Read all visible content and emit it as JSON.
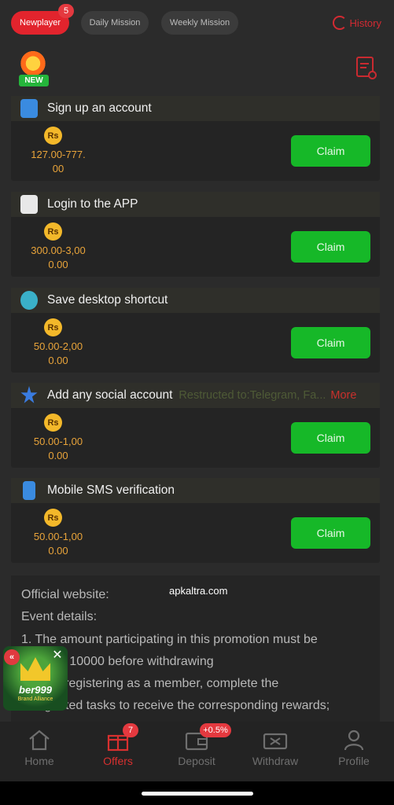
{
  "tabs": [
    {
      "label": "Newplayer",
      "badge": "5",
      "active": true
    },
    {
      "label": "Daily Mission",
      "active": false
    },
    {
      "label": "Weekly Mission",
      "active": false
    }
  ],
  "history_label": "History",
  "new_tag": "NEW",
  "currency_symbol": "Rs",
  "claim_label": "Claim",
  "tasks": [
    {
      "title": "Sign up an account",
      "note": "",
      "more": "",
      "reward_line1": "127.00-777.",
      "reward_line2": "00",
      "icon": "account-icon"
    },
    {
      "title": "Login to the APP",
      "note": "",
      "more": "",
      "reward_line1": "300.00-3,00",
      "reward_line2": "0.00",
      "icon": "app-icon"
    },
    {
      "title": "Save desktop shortcut",
      "note": "",
      "more": "",
      "reward_line1": "50.00-2,00",
      "reward_line2": "0.00",
      "icon": "globe-icon"
    },
    {
      "title": "Add any social account",
      "note": "Restructed to:Telegram, Fa...",
      "more": "More",
      "reward_line1": "50.00-1,00",
      "reward_line2": "0.00",
      "icon": "social-icon"
    },
    {
      "title": "Mobile SMS verification",
      "note": "",
      "more": "",
      "reward_line1": "50.00-1,00",
      "reward_line2": "0.00",
      "icon": "phone-icon"
    }
  ],
  "description": {
    "line1": "Official website:",
    "line2": "Event details:",
    "line3": "1. The amount participating in this promotion must be",
    "line4": "equal to 10000 before withdrawing",
    "line5": "2. After registering as a member, complete the",
    "line6": "designated tasks to receive the corresponding rewards;"
  },
  "watermark": "apkaltra.com",
  "float_promo": {
    "brand": "ber999",
    "subtitle": "Brand Alliance",
    "close": "✕",
    "up": "«"
  },
  "nav": [
    {
      "label": "Home",
      "active": false,
      "badge": ""
    },
    {
      "label": "Offers",
      "active": true,
      "badge": "7"
    },
    {
      "label": "Deposit",
      "active": false,
      "badge": "+0.5%"
    },
    {
      "label": "Withdraw",
      "active": false,
      "badge": ""
    },
    {
      "label": "Profile",
      "active": false,
      "badge": ""
    }
  ],
  "colors": {
    "accent": "#e2242d",
    "claim": "#16b828",
    "reward": "#e9a43a",
    "background": "#2b2b2b"
  }
}
